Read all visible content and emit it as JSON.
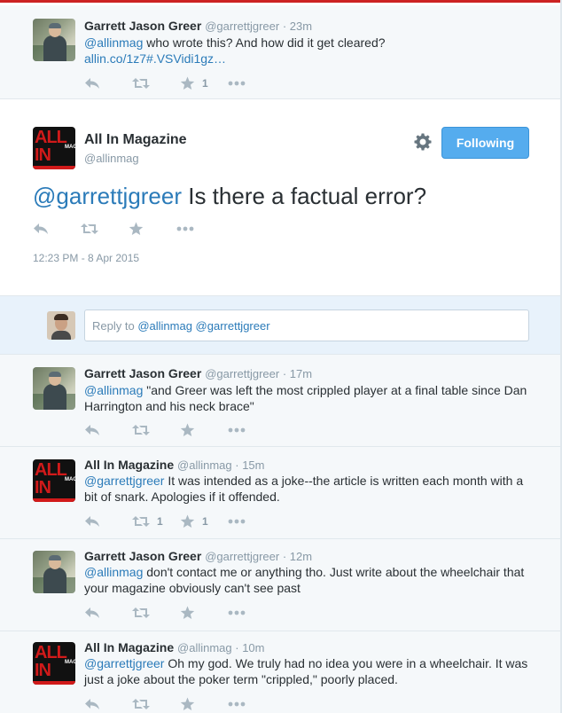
{
  "tweets": [
    {
      "fullname": "Garrett Jason Greer",
      "handle": "@garrettjgreer",
      "time": "23m",
      "mention": "@allinmag",
      "text": " who wrote this? And how did it get cleared?",
      "link": "allin.co/1z7#.VSVidi1gz…",
      "retweets": "",
      "favorites": "1"
    },
    {
      "fullname": "Garrett Jason Greer",
      "handle": "@garrettjgreer",
      "time": "17m",
      "mention": "@allinmag",
      "text": " \"and Greer was left the most crippled player at a final table since Dan Harrington and his neck brace\"",
      "retweets": "",
      "favorites": ""
    },
    {
      "fullname": "All In Magazine",
      "handle": "@allinmag",
      "time": "15m",
      "mention": "@garrettjgreer",
      "text": " It was intended as a joke--the article is written each month with a bit of snark. Apologies if it offended.",
      "retweets": "1",
      "favorites": "1"
    },
    {
      "fullname": "Garrett Jason Greer",
      "handle": "@garrettjgreer",
      "time": "12m",
      "mention": "@allinmag",
      "text": " don't contact me or anything tho. Just write about the wheelchair that your magazine obviously can't see past",
      "retweets": "",
      "favorites": ""
    },
    {
      "fullname": "All In Magazine",
      "handle": "@allinmag",
      "time": "10m",
      "mention": "@garrettjgreer",
      "text": " Oh my god. We truly had no idea you were in a wheelchair. It was just a joke about the poker term \"crippled,\" poorly placed.",
      "retweets": "",
      "favorites": ""
    }
  ],
  "main_tweet": {
    "fullname": "All In Magazine",
    "handle": "@allinmag",
    "follow_label": "Following",
    "mention": "@garrettjgreer",
    "text": " Is there a factual error?",
    "timestamp": "12:23 PM - 8 Apr 2015"
  },
  "reply_box": {
    "prefix": "Reply to ",
    "handles": "@allinmag @garrettjgreer"
  },
  "avatar_logo": {
    "line1": "ALL",
    "line2": "IN",
    "side": "MAG"
  },
  "separator": " · ",
  "icons": {
    "reply": "reply-icon",
    "retweet": "retweet-icon",
    "favorite": "star-icon",
    "more": "more-icon",
    "gear": "gear-icon"
  },
  "colors": {
    "link": "#2b7bb9",
    "follow_button": "#55acee",
    "muted": "#8899a6",
    "action_icons": "#aab8c2"
  }
}
